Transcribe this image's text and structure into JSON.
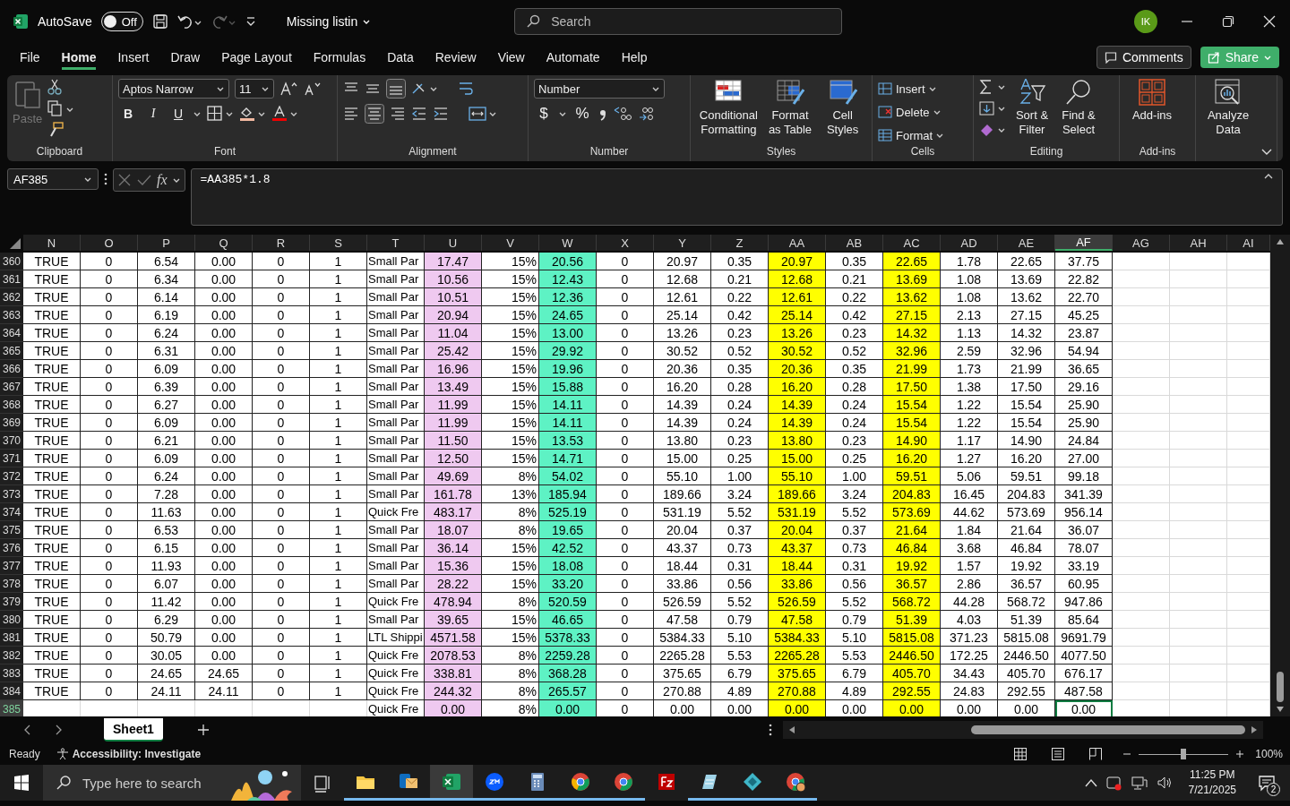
{
  "title_bar": {
    "autosave_label": "AutoSave",
    "autosave": {
      "on": false,
      "label": "Off"
    },
    "document_title": "Missing listin",
    "search_placeholder": "Search",
    "avatar_initials": "IK"
  },
  "menu_tabs": [
    {
      "label": "File",
      "selected": false
    },
    {
      "label": "Home",
      "selected": true
    },
    {
      "label": "Insert",
      "selected": false
    },
    {
      "label": "Draw",
      "selected": false
    },
    {
      "label": "Page Layout",
      "selected": false
    },
    {
      "label": "Formulas",
      "selected": false
    },
    {
      "label": "Data",
      "selected": false
    },
    {
      "label": "Review",
      "selected": false
    },
    {
      "label": "View",
      "selected": false
    },
    {
      "label": "Automate",
      "selected": false
    },
    {
      "label": "Help",
      "selected": false
    }
  ],
  "comments_button": "Comments",
  "share_button": "Share",
  "ribbon": {
    "paste_label": "Paste",
    "font_name": "Aptos Narrow",
    "font_size": "11",
    "format_buttons": [
      "B",
      "I",
      "U"
    ],
    "number_format": "Number",
    "number_buttons": [
      "$",
      "%"
    ],
    "styles_buttons": [
      "Conditional Formatting",
      "Format as Table",
      "Cell Styles"
    ],
    "cells_buttons": [
      "Insert",
      "Delete",
      "Format"
    ],
    "editing_buttons": [
      "Sort & Filter",
      "Find & Select"
    ],
    "addins_button": "Add-ins",
    "analyze_button": "Analyze Data",
    "groups": [
      "Clipboard",
      "Font",
      "Alignment",
      "Number",
      "Styles",
      "Cells",
      "Editing",
      "Add-ins"
    ]
  },
  "formula_bar": {
    "name_box": "AF385",
    "function_label": "fx",
    "formula": "=AA385*1.8"
  },
  "columns": [
    {
      "label": "N",
      "kind": "value",
      "selected": false
    },
    {
      "label": "O",
      "kind": "value",
      "selected": false
    },
    {
      "label": "P",
      "kind": "value",
      "selected": false
    },
    {
      "label": "Q",
      "kind": "value",
      "selected": false
    },
    {
      "label": "R",
      "kind": "value",
      "selected": false
    },
    {
      "label": "S",
      "kind": "value",
      "selected": false
    },
    {
      "label": "T",
      "kind": "text",
      "selected": false
    },
    {
      "label": "U",
      "kind": "value",
      "selected": false,
      "color": "#efc9f0"
    },
    {
      "label": "V",
      "kind": "percent",
      "selected": false
    },
    {
      "label": "W",
      "kind": "value",
      "selected": false,
      "color": "#5ef2c4"
    },
    {
      "label": "X",
      "kind": "value",
      "selected": false
    },
    {
      "label": "Y",
      "kind": "value",
      "selected": false
    },
    {
      "label": "Z",
      "kind": "value",
      "selected": false
    },
    {
      "label": "AA",
      "kind": "value",
      "selected": false,
      "color": "#ffff00"
    },
    {
      "label": "AB",
      "kind": "value",
      "selected": false
    },
    {
      "label": "AC",
      "kind": "value",
      "selected": false,
      "color": "#ffff00"
    },
    {
      "label": "AD",
      "kind": "value",
      "selected": false
    },
    {
      "label": "AE",
      "kind": "value",
      "selected": false
    },
    {
      "label": "AF",
      "kind": "value",
      "selected": true
    },
    {
      "label": "AG",
      "selected": false
    },
    {
      "label": "AH",
      "selected": false
    },
    {
      "label": "AI",
      "selected": false
    }
  ],
  "rows": [
    {
      "number": "360",
      "selected": false,
      "cells": [
        "TRUE",
        "0",
        "6.54",
        "0.00",
        "0",
        "1",
        "Small Par",
        "17.47",
        "15%",
        "20.56",
        "0",
        "20.97",
        "0.35",
        "20.97",
        "0.35",
        "22.65",
        "1.78",
        "22.65",
        "37.75"
      ]
    },
    {
      "number": "361",
      "selected": false,
      "cells": [
        "TRUE",
        "0",
        "6.34",
        "0.00",
        "0",
        "1",
        "Small Par",
        "10.56",
        "15%",
        "12.43",
        "0",
        "12.68",
        "0.21",
        "12.68",
        "0.21",
        "13.69",
        "1.08",
        "13.69",
        "22.82"
      ]
    },
    {
      "number": "362",
      "selected": false,
      "cells": [
        "TRUE",
        "0",
        "6.14",
        "0.00",
        "0",
        "1",
        "Small Par",
        "10.51",
        "15%",
        "12.36",
        "0",
        "12.61",
        "0.22",
        "12.61",
        "0.22",
        "13.62",
        "1.08",
        "13.62",
        "22.70"
      ]
    },
    {
      "number": "363",
      "selected": false,
      "cells": [
        "TRUE",
        "0",
        "6.19",
        "0.00",
        "0",
        "1",
        "Small Par",
        "20.94",
        "15%",
        "24.65",
        "0",
        "25.14",
        "0.42",
        "25.14",
        "0.42",
        "27.15",
        "2.13",
        "27.15",
        "45.25"
      ]
    },
    {
      "number": "364",
      "selected": false,
      "cells": [
        "TRUE",
        "0",
        "6.24",
        "0.00",
        "0",
        "1",
        "Small Par",
        "11.04",
        "15%",
        "13.00",
        "0",
        "13.26",
        "0.23",
        "13.26",
        "0.23",
        "14.32",
        "1.13",
        "14.32",
        "23.87"
      ]
    },
    {
      "number": "365",
      "selected": false,
      "cells": [
        "TRUE",
        "0",
        "6.31",
        "0.00",
        "0",
        "1",
        "Small Par",
        "25.42",
        "15%",
        "29.92",
        "0",
        "30.52",
        "0.52",
        "30.52",
        "0.52",
        "32.96",
        "2.59",
        "32.96",
        "54.94"
      ]
    },
    {
      "number": "366",
      "selected": false,
      "cells": [
        "TRUE",
        "0",
        "6.09",
        "0.00",
        "0",
        "1",
        "Small Par",
        "16.96",
        "15%",
        "19.96",
        "0",
        "20.36",
        "0.35",
        "20.36",
        "0.35",
        "21.99",
        "1.73",
        "21.99",
        "36.65"
      ]
    },
    {
      "number": "367",
      "selected": false,
      "cells": [
        "TRUE",
        "0",
        "6.39",
        "0.00",
        "0",
        "1",
        "Small Par",
        "13.49",
        "15%",
        "15.88",
        "0",
        "16.20",
        "0.28",
        "16.20",
        "0.28",
        "17.50",
        "1.38",
        "17.50",
        "29.16"
      ]
    },
    {
      "number": "368",
      "selected": false,
      "cells": [
        "TRUE",
        "0",
        "6.27",
        "0.00",
        "0",
        "1",
        "Small Par",
        "11.99",
        "15%",
        "14.11",
        "0",
        "14.39",
        "0.24",
        "14.39",
        "0.24",
        "15.54",
        "1.22",
        "15.54",
        "25.90"
      ]
    },
    {
      "number": "369",
      "selected": false,
      "cells": [
        "TRUE",
        "0",
        "6.09",
        "0.00",
        "0",
        "1",
        "Small Par",
        "11.99",
        "15%",
        "14.11",
        "0",
        "14.39",
        "0.24",
        "14.39",
        "0.24",
        "15.54",
        "1.22",
        "15.54",
        "25.90"
      ]
    },
    {
      "number": "370",
      "selected": false,
      "cells": [
        "TRUE",
        "0",
        "6.21",
        "0.00",
        "0",
        "1",
        "Small Par",
        "11.50",
        "15%",
        "13.53",
        "0",
        "13.80",
        "0.23",
        "13.80",
        "0.23",
        "14.90",
        "1.17",
        "14.90",
        "24.84"
      ]
    },
    {
      "number": "371",
      "selected": false,
      "cells": [
        "TRUE",
        "0",
        "6.09",
        "0.00",
        "0",
        "1",
        "Small Par",
        "12.50",
        "15%",
        "14.71",
        "0",
        "15.00",
        "0.25",
        "15.00",
        "0.25",
        "16.20",
        "1.27",
        "16.20",
        "27.00"
      ]
    },
    {
      "number": "372",
      "selected": false,
      "cells": [
        "TRUE",
        "0",
        "6.24",
        "0.00",
        "0",
        "1",
        "Small Par",
        "49.69",
        "8%",
        "54.02",
        "0",
        "55.10",
        "1.00",
        "55.10",
        "1.00",
        "59.51",
        "5.06",
        "59.51",
        "99.18"
      ]
    },
    {
      "number": "373",
      "selected": false,
      "cells": [
        "TRUE",
        "0",
        "7.28",
        "0.00",
        "0",
        "1",
        "Small Par",
        "161.78",
        "13%",
        "185.94",
        "0",
        "189.66",
        "3.24",
        "189.66",
        "3.24",
        "204.83",
        "16.45",
        "204.83",
        "341.39"
      ]
    },
    {
      "number": "374",
      "selected": false,
      "cells": [
        "TRUE",
        "0",
        "11.63",
        "0.00",
        "0",
        "1",
        "Quick Fre",
        "483.17",
        "8%",
        "525.19",
        "0",
        "531.19",
        "5.52",
        "531.19",
        "5.52",
        "573.69",
        "44.62",
        "573.69",
        "956.14"
      ]
    },
    {
      "number": "375",
      "selected": false,
      "cells": [
        "TRUE",
        "0",
        "6.53",
        "0.00",
        "0",
        "1",
        "Small Par",
        "18.07",
        "8%",
        "19.65",
        "0",
        "20.04",
        "0.37",
        "20.04",
        "0.37",
        "21.64",
        "1.84",
        "21.64",
        "36.07"
      ]
    },
    {
      "number": "376",
      "selected": false,
      "cells": [
        "TRUE",
        "0",
        "6.15",
        "0.00",
        "0",
        "1",
        "Small Par",
        "36.14",
        "15%",
        "42.52",
        "0",
        "43.37",
        "0.73",
        "43.37",
        "0.73",
        "46.84",
        "3.68",
        "46.84",
        "78.07"
      ]
    },
    {
      "number": "377",
      "selected": false,
      "cells": [
        "TRUE",
        "0",
        "11.93",
        "0.00",
        "0",
        "1",
        "Small Par",
        "15.36",
        "15%",
        "18.08",
        "0",
        "18.44",
        "0.31",
        "18.44",
        "0.31",
        "19.92",
        "1.57",
        "19.92",
        "33.19"
      ]
    },
    {
      "number": "378",
      "selected": false,
      "cells": [
        "TRUE",
        "0",
        "6.07",
        "0.00",
        "0",
        "1",
        "Small Par",
        "28.22",
        "15%",
        "33.20",
        "0",
        "33.86",
        "0.56",
        "33.86",
        "0.56",
        "36.57",
        "2.86",
        "36.57",
        "60.95"
      ]
    },
    {
      "number": "379",
      "selected": false,
      "cells": [
        "TRUE",
        "0",
        "11.42",
        "0.00",
        "0",
        "1",
        "Quick Fre",
        "478.94",
        "8%",
        "520.59",
        "0",
        "526.59",
        "5.52",
        "526.59",
        "5.52",
        "568.72",
        "44.28",
        "568.72",
        "947.86"
      ]
    },
    {
      "number": "380",
      "selected": false,
      "cells": [
        "TRUE",
        "0",
        "6.29",
        "0.00",
        "0",
        "1",
        "Small Par",
        "39.65",
        "15%",
        "46.65",
        "0",
        "47.58",
        "0.79",
        "47.58",
        "0.79",
        "51.39",
        "4.03",
        "51.39",
        "85.64"
      ]
    },
    {
      "number": "381",
      "selected": false,
      "cells": [
        "TRUE",
        "0",
        "50.79",
        "0.00",
        "0",
        "1",
        "LTL Shippi",
        "4571.58",
        "15%",
        "5378.33",
        "0",
        "5384.33",
        "5.10",
        "5384.33",
        "5.10",
        "5815.08",
        "371.23",
        "5815.08",
        "9691.79"
      ]
    },
    {
      "number": "382",
      "selected": false,
      "cells": [
        "TRUE",
        "0",
        "30.05",
        "0.00",
        "0",
        "1",
        "Quick Fre",
        "2078.53",
        "8%",
        "2259.28",
        "0",
        "2265.28",
        "5.53",
        "2265.28",
        "5.53",
        "2446.50",
        "172.25",
        "2446.50",
        "4077.50"
      ]
    },
    {
      "number": "383",
      "selected": false,
      "cells": [
        "TRUE",
        "0",
        "24.65",
        "24.65",
        "0",
        "1",
        "Quick Fre",
        "338.81",
        "8%",
        "368.28",
        "0",
        "375.65",
        "6.79",
        "375.65",
        "6.79",
        "405.70",
        "34.43",
        "405.70",
        "676.17"
      ]
    },
    {
      "number": "384",
      "selected": false,
      "cells": [
        "TRUE",
        "0",
        "24.11",
        "24.11",
        "0",
        "1",
        "Quick Fre",
        "244.32",
        "8%",
        "265.57",
        "0",
        "270.88",
        "4.89",
        "270.88",
        "4.89",
        "292.55",
        "24.83",
        "292.55",
        "487.58"
      ]
    },
    {
      "number": "385",
      "selected": true,
      "cells": [
        null,
        null,
        null,
        null,
        null,
        null,
        "Quick Fre",
        "0.00",
        "8%",
        "0.00",
        "0",
        "0.00",
        "0.00",
        "0.00",
        "0.00",
        "0.00",
        "0.00",
        "0.00",
        "0.00"
      ]
    }
  ],
  "sheet_tabs": [
    {
      "label": "Sheet1",
      "selected": true
    }
  ],
  "status_bar": {
    "mode": "Ready",
    "accessibility": "Accessibility: Investigate",
    "zoom": {
      "level": 0.5,
      "reading": "100%"
    }
  },
  "taskbar": {
    "search_placeholder": "Type here to search",
    "time": "11:25 PM",
    "date": "7/21/2025",
    "notifications": "2"
  }
}
